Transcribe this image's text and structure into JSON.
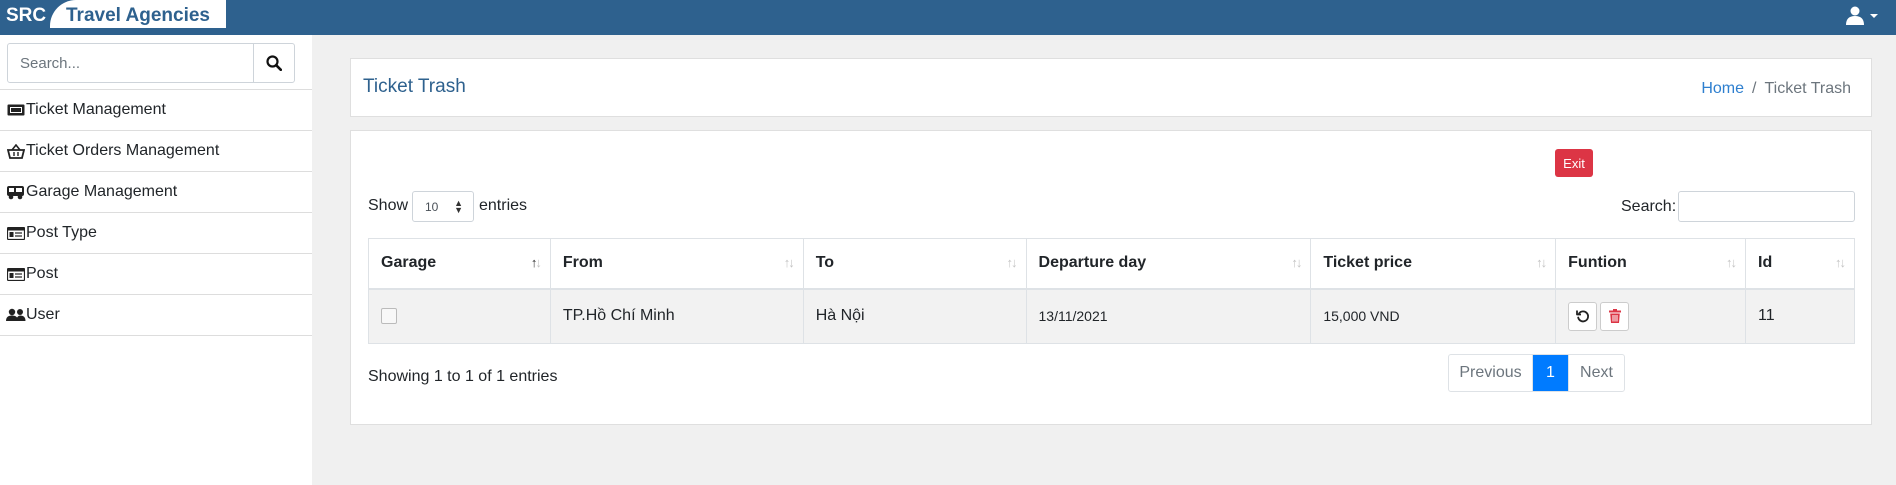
{
  "header": {
    "brand_short": "SRC",
    "brand_name": "Travel Agencies",
    "user_icon": "user-icon"
  },
  "sidebar": {
    "search_placeholder": "Search...",
    "items": [
      {
        "label": "Ticket Management",
        "icon": "ticket-icon"
      },
      {
        "label": "Ticket Orders Management",
        "icon": "basket-icon"
      },
      {
        "label": "Garage Management",
        "icon": "bus-icon"
      },
      {
        "label": "Post Type",
        "icon": "id-card-icon"
      },
      {
        "label": "Post",
        "icon": "id-card-icon"
      },
      {
        "label": "User",
        "icon": "users-icon"
      }
    ]
  },
  "page": {
    "title": "Ticket Trash",
    "breadcrumb": {
      "home": "Home",
      "current": "Ticket Trash"
    }
  },
  "main": {
    "exit_label": "Exit",
    "show_label": "Show",
    "show_value": "10",
    "entries_label": "entries",
    "search_label": "Search:",
    "columns": [
      "Garage",
      "From",
      "To",
      "Departure day",
      "Ticket price",
      "Funtion",
      "Id"
    ],
    "rows": [
      {
        "from": "TP.Hồ Chí Minh",
        "to": "Hà Nội",
        "departure": "13/11/2021",
        "price": "15,000 VND",
        "id": "11"
      }
    ],
    "info": "Showing 1 to 1 of 1 entries",
    "pager": {
      "previous": "Previous",
      "current": "1",
      "next": "Next"
    }
  },
  "colors": {
    "topbar": "#2e618e",
    "exit": "#dc3545",
    "active_page": "#007bff"
  }
}
